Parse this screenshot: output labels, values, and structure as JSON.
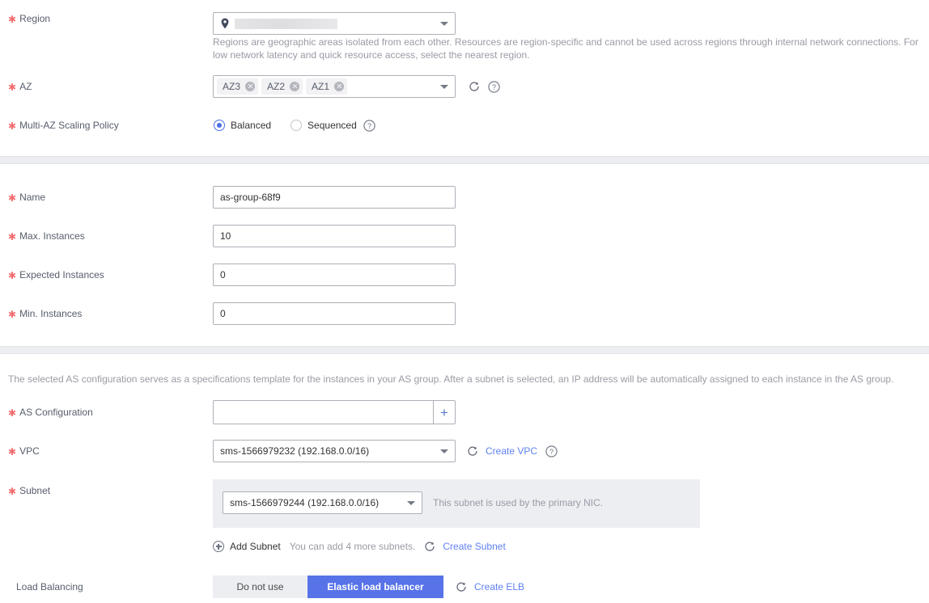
{
  "form": {
    "region": {
      "label": "Region",
      "required": true,
      "value": "",
      "redacted": true,
      "icon": "location-pin-icon",
      "description": "Regions are geographic areas isolated from each other. Resources are region-specific and cannot be used across regions through internal network connections. For low network latency and quick resource access, select the nearest region."
    },
    "az": {
      "label": "AZ",
      "required": true,
      "tags": [
        "AZ3",
        "AZ2",
        "AZ1"
      ],
      "refresh_icon": "refresh-icon",
      "help_icon": "help-circle-icon"
    },
    "multi_az_policy": {
      "label": "Multi-AZ Scaling Policy",
      "required": true,
      "options": [
        {
          "label": "Balanced",
          "selected": true
        },
        {
          "label": "Sequenced",
          "selected": false
        }
      ],
      "help_icon": "help-circle-icon"
    },
    "name": {
      "label": "Name",
      "required": true,
      "value": "as-group-68f9"
    },
    "max_instances": {
      "label": "Max. Instances",
      "required": true,
      "value": "10"
    },
    "expected_instances": {
      "label": "Expected Instances",
      "required": true,
      "value": "0"
    },
    "min_instances": {
      "label": "Min. Instances",
      "required": true,
      "value": "0"
    },
    "as_config_description": "The selected AS configuration serves as a specifications template for the instances in your AS group. After a subnet is selected, an IP address will be automatically assigned to each instance in the AS group.",
    "as_configuration": {
      "label": "AS Configuration",
      "required": true,
      "value": "",
      "add_button": "+"
    },
    "vpc": {
      "label": "VPC",
      "required": true,
      "value": "sms-1566979232 (192.168.0.0/16)",
      "refresh_icon": "refresh-icon",
      "create_link": "Create VPC",
      "help_icon": "help-circle-icon"
    },
    "subnet": {
      "label": "Subnet",
      "required": true,
      "value": "sms-1566979244 (192.168.0.0/16)",
      "note": "This subnet is used by the primary NIC.",
      "add_subnet_label": "Add Subnet",
      "add_subnet_hint": "You can add 4 more subnets.",
      "refresh_icon": "refresh-icon",
      "create_link": "Create Subnet"
    },
    "load_balancing": {
      "label": "Load Balancing",
      "required": false,
      "options": [
        {
          "label": "Do not use",
          "selected": false
        },
        {
          "label": "Elastic load balancer",
          "selected": true
        }
      ],
      "refresh_icon": "refresh-icon",
      "create_link": "Create ELB"
    }
  },
  "colors": {
    "accent": "#5873e8",
    "link": "#5f80f2",
    "required_star": "#f36d6f",
    "label_text": "#575d6c",
    "muted_text": "#9a9ba5",
    "panel_bg": "#eceef2",
    "border": "#adb0b8"
  }
}
